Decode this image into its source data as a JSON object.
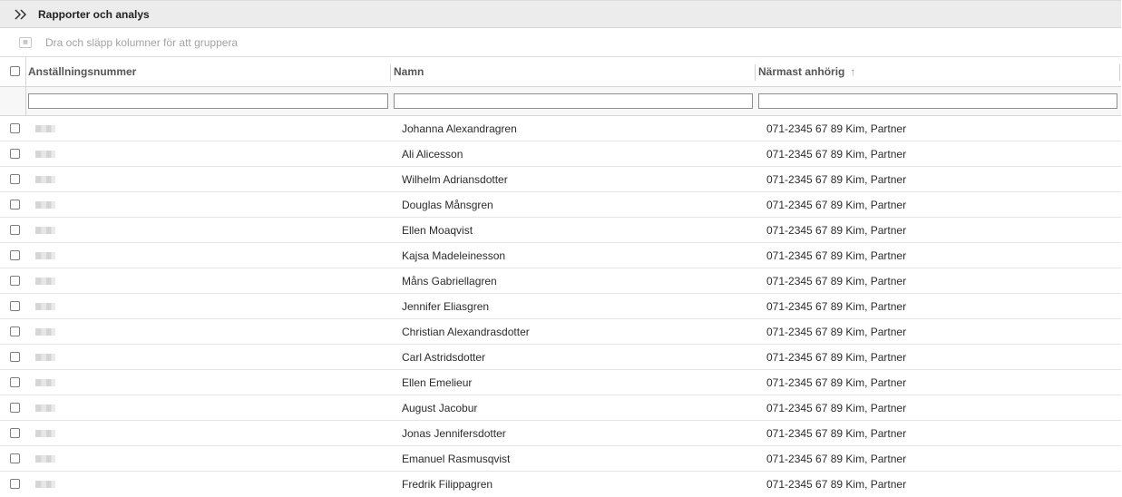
{
  "topbar": {
    "title": "Rapporter och analys",
    "toggle_icon": "double-chevron-right-icon"
  },
  "groupbar": {
    "hint": "Dra och släpp kolumner för att gruppera",
    "icon": "group-by-icon"
  },
  "columns": [
    {
      "label": "Anställningsnummer"
    },
    {
      "label": "Namn"
    },
    {
      "label": "Närmast anhörig",
      "sort": "↑"
    }
  ],
  "filters": [
    "",
    "",
    ""
  ],
  "rows": [
    {
      "name": "Johanna Alexandragren",
      "kin": "071-2345 67 89 Kim, Partner"
    },
    {
      "name": "Ali Alicesson",
      "kin": "071-2345 67 89 Kim, Partner"
    },
    {
      "name": "Wilhelm Adriansdotter",
      "kin": "071-2345 67 89 Kim, Partner"
    },
    {
      "name": "Douglas Månsgren",
      "kin": "071-2345 67 89 Kim, Partner"
    },
    {
      "name": "Ellen Moaqvist",
      "kin": "071-2345 67 89 Kim, Partner"
    },
    {
      "name": "Kajsa Madeleinesson",
      "kin": "071-2345 67 89 Kim, Partner"
    },
    {
      "name": "Måns Gabriellagren",
      "kin": "071-2345 67 89 Kim, Partner"
    },
    {
      "name": "Jennifer Eliasgren",
      "kin": "071-2345 67 89 Kim, Partner"
    },
    {
      "name": "Christian Alexandrasdotter",
      "kin": "071-2345 67 89 Kim, Partner"
    },
    {
      "name": "Carl Astridsdotter",
      "kin": "071-2345 67 89 Kim, Partner"
    },
    {
      "name": "Ellen Emelieur",
      "kin": "071-2345 67 89 Kim, Partner"
    },
    {
      "name": "August Jacobur",
      "kin": "071-2345 67 89 Kim, Partner"
    },
    {
      "name": "Jonas Jennifersdotter",
      "kin": "071-2345 67 89 Kim, Partner"
    },
    {
      "name": "Emanuel Rasmusqvist",
      "kin": "071-2345 67 89 Kim, Partner"
    },
    {
      "name": "Fredrik Filippagren",
      "kin": "071-2345 67 89 Kim, Partner"
    }
  ]
}
